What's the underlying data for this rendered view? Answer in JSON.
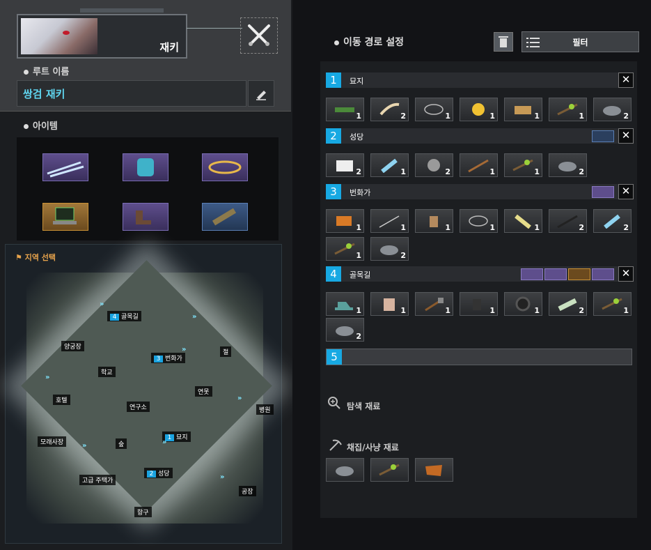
{
  "character": {
    "name": "재키"
  },
  "left": {
    "route_name_label": "루트 이름",
    "route_name_value": "쌍검 재키",
    "items_label": "아이템",
    "map_title": "지역 선택",
    "map_labels": [
      {
        "text": "골목길",
        "num": "4"
      },
      {
        "text": "양궁장",
        "num": ""
      },
      {
        "text": "번화가",
        "num": "3"
      },
      {
        "text": "절",
        "num": ""
      },
      {
        "text": "학교",
        "num": ""
      },
      {
        "text": "호텔",
        "num": ""
      },
      {
        "text": "연구소",
        "num": ""
      },
      {
        "text": "연못",
        "num": ""
      },
      {
        "text": "병원",
        "num": ""
      },
      {
        "text": "모래사장",
        "num": ""
      },
      {
        "text": "숲",
        "num": ""
      },
      {
        "text": "묘지",
        "num": "1"
      },
      {
        "text": "고급 주택가",
        "num": ""
      },
      {
        "text": "성당",
        "num": "2"
      },
      {
        "text": "공장",
        "num": ""
      },
      {
        "text": "항구",
        "num": ""
      }
    ]
  },
  "right": {
    "title": "이동 경로 설정",
    "filter_label": "필터",
    "rows": [
      {
        "num": "1",
        "name": "묘지",
        "counts": [
          "1",
          "2",
          "1",
          "1",
          "1",
          "1",
          "2"
        ]
      },
      {
        "num": "2",
        "name": "성당",
        "counts": [
          "2",
          "1",
          "2",
          "1",
          "1",
          "2"
        ]
      },
      {
        "num": "3",
        "name": "번화가",
        "counts": [
          "1",
          "1",
          "1",
          "1",
          "1",
          "2",
          "2",
          "1",
          "2"
        ]
      },
      {
        "num": "4",
        "name": "골목길",
        "counts": [
          "1",
          "1",
          "1",
          "1",
          "1",
          "2",
          "1",
          "2"
        ]
      }
    ],
    "row5_num": "5",
    "explore_label": "탐색 재료",
    "gather_label": "채집/사냥 재료"
  },
  "colors": {
    "accent_blue": "#17a9e3",
    "route_cyan": "#5fd4ee",
    "map_title": "#e8a44c"
  }
}
